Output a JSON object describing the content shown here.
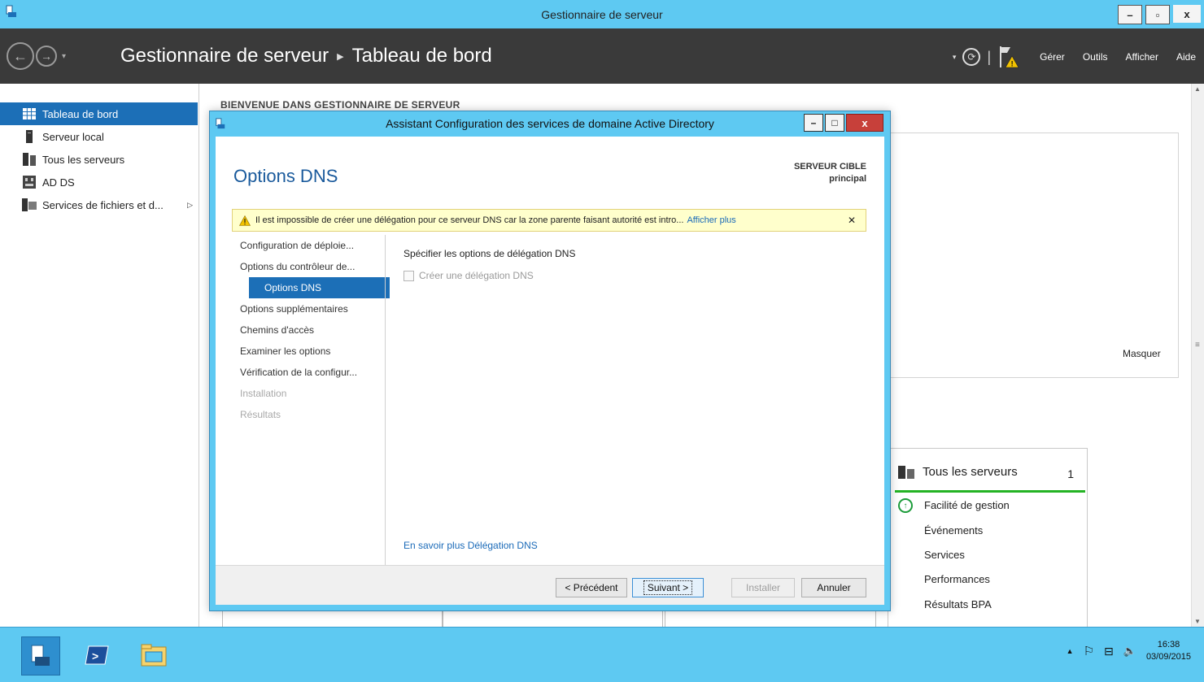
{
  "window": {
    "title": "Gestionnaire de serveur"
  },
  "header": {
    "breadcrumb": [
      "Gestionnaire de serveur",
      "Tableau de bord"
    ],
    "menu": [
      "Gérer",
      "Outils",
      "Afficher",
      "Aide"
    ]
  },
  "sidebar": {
    "items": [
      {
        "label": "Tableau de bord",
        "icon": "dashboard-grid-icon",
        "active": true
      },
      {
        "label": "Serveur local",
        "icon": "server-icon"
      },
      {
        "label": "Tous les serveurs",
        "icon": "servers-icon"
      },
      {
        "label": "AD DS",
        "icon": "adds-icon"
      },
      {
        "label": "Services de fichiers et d...",
        "icon": "file-services-icon"
      }
    ]
  },
  "main": {
    "welcome_heading": "BIENVENUE DANS GESTIONNAIRE DE SERVEUR",
    "hide_label": "Masquer",
    "server_card": {
      "title": "Tous les serveurs",
      "count": "1",
      "rows": [
        "Facilité de gestion",
        "Événements",
        "Services",
        "Performances",
        "Résultats BPA"
      ]
    }
  },
  "dialog": {
    "title": "Assistant Configuration des services de domaine Active Directory",
    "heading": "Options DNS",
    "target_label": "SERVEUR CIBLE",
    "target_name": "principal",
    "warning_text": "Il est impossible de créer une délégation pour ce serveur DNS car la zone parente faisant autorité est intro...",
    "warning_more": "Afficher plus",
    "steps": [
      {
        "label": "Configuration de déploie...",
        "state": "done"
      },
      {
        "label": "Options du contrôleur de...",
        "state": "done"
      },
      {
        "label": "Options DNS",
        "state": "active"
      },
      {
        "label": "Options supplémentaires",
        "state": "pending"
      },
      {
        "label": "Chemins d'accès",
        "state": "pending"
      },
      {
        "label": "Examiner les options",
        "state": "pending"
      },
      {
        "label": "Vérification de la configur...",
        "state": "pending"
      },
      {
        "label": "Installation",
        "state": "disabled"
      },
      {
        "label": "Résultats",
        "state": "disabled"
      }
    ],
    "content_title": "Spécifier les options de délégation DNS",
    "checkbox_label": "Créer une délégation DNS",
    "learn_more": "En savoir plus Délégation DNS",
    "buttons": {
      "previous": "< Précédent",
      "next": "Suivant >",
      "install": "Installer",
      "cancel": "Annuler"
    }
  },
  "taskbar": {
    "time": "16:38",
    "date": "03/09/2015"
  },
  "colors": {
    "accent": "#1c6fb7",
    "titlebar": "#5ec9f2",
    "header": "#3a3a3a",
    "warning_bg": "#ffffcc",
    "status_green": "#24b324"
  }
}
